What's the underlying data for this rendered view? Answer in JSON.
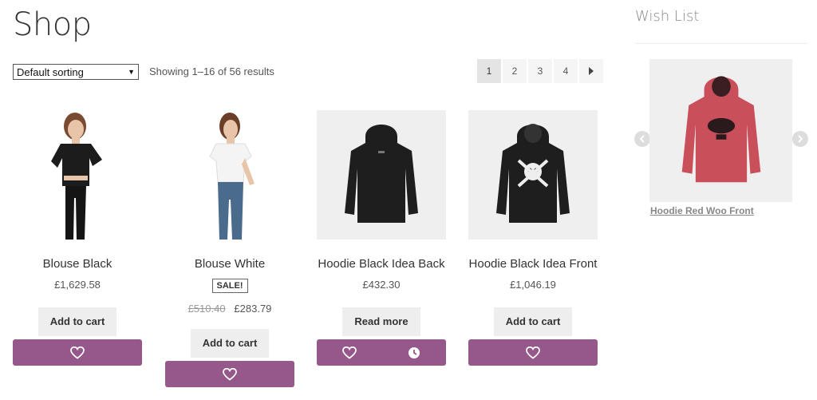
{
  "page": {
    "title": "Shop"
  },
  "toolbar": {
    "sort_selected": "Default sorting",
    "result_count": "Showing 1–16 of 56 results"
  },
  "pagination": {
    "pages": [
      "1",
      "2",
      "3",
      "4"
    ],
    "current": "1",
    "next_icon": "chevron-right-icon"
  },
  "products": [
    {
      "title": "Blouse Black",
      "price": "£1,629.58",
      "button": "Add to cart"
    },
    {
      "title": "Blouse White",
      "badge": "SALE!",
      "old_price": "£510.40",
      "price": "£283.79",
      "button": "Add to cart"
    },
    {
      "title": "Hoodie Black Idea Back",
      "price": "£432.30",
      "button": "Read more"
    },
    {
      "title": "Hoodie Black Idea Front",
      "price": "£1,046.19",
      "button": "Add to cart"
    }
  ],
  "sidebar": {
    "title": "Wish List",
    "item_link": "Hoodie Red Woo Front"
  },
  "colors": {
    "accent": "#96588a",
    "button_bg": "#eeeeee",
    "hoodie_red": "#c9505b",
    "hoodie_black": "#1e1e1e"
  }
}
